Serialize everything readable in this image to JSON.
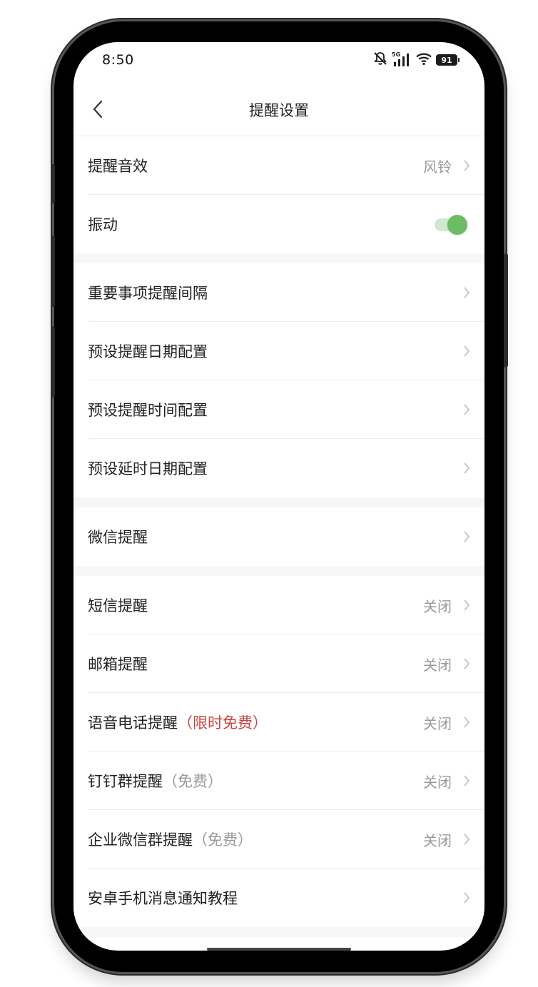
{
  "status_bar": {
    "time": "8:50",
    "network": "5G",
    "battery": "91",
    "icons": [
      "silent-bell-icon",
      "signal-icon",
      "wifi-icon",
      "battery-icon"
    ]
  },
  "nav": {
    "title": "提醒设置",
    "back_icon": "chevron-left-icon"
  },
  "rows": {
    "sound": {
      "label": "提醒音效",
      "value": "风铃"
    },
    "vibration": {
      "label": "振动",
      "enabled": true,
      "accent": "#6dbb63"
    },
    "interval": {
      "label": "重要事项提醒间隔"
    },
    "preset_date": {
      "label": "预设提醒日期配置"
    },
    "preset_time": {
      "label": "预设提醒时间配置"
    },
    "preset_delay": {
      "label": "预设延时日期配置"
    },
    "wechat": {
      "label": "微信提醒"
    },
    "sms": {
      "label": "短信提醒",
      "value": "关闭"
    },
    "email": {
      "label": "邮箱提醒",
      "value": "关闭"
    },
    "voice_call": {
      "label": "语音电话提醒",
      "suffix": "（限时免费）",
      "suffix_color": "#c9433f",
      "value": "关闭"
    },
    "dingtalk": {
      "label": "钉钉群提醒",
      "suffix": "（免费）",
      "value": "关闭"
    },
    "wecom": {
      "label": "企业微信群提醒",
      "suffix": "（免费）",
      "value": "关闭"
    },
    "android_tutorial": {
      "label": "安卓手机消息通知教程"
    }
  }
}
